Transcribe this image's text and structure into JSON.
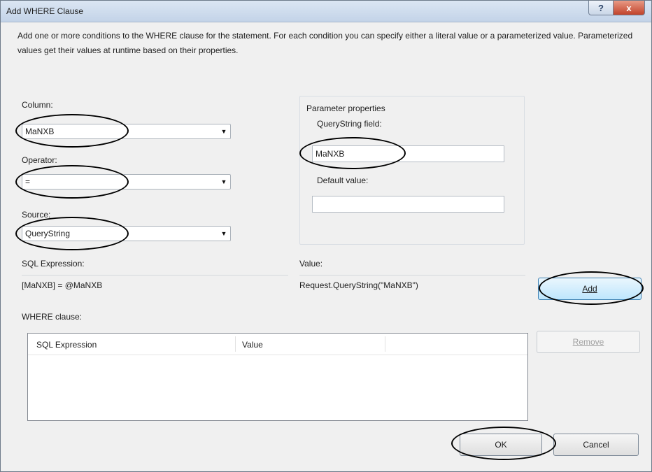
{
  "window": {
    "title": "Add WHERE Clause",
    "help_icon": "?",
    "close_icon": "x"
  },
  "description": "Add one or more conditions to the WHERE clause for the statement. For each condition you can specify either a literal value or a parameterized value. Parameterized values get their values at runtime based on their properties.",
  "column": {
    "label": "Column:",
    "value": "MaNXB"
  },
  "operator": {
    "label": "Operator:",
    "value": "="
  },
  "source": {
    "label": "Source:",
    "value": "QueryString"
  },
  "parameter_properties": {
    "title": "Parameter properties",
    "querystring_label": "QueryString field:",
    "querystring_value": "MaNXB",
    "default_label": "Default value:",
    "default_value": ""
  },
  "sql_expression": {
    "label": "SQL Expression:",
    "value": "[MaNXB] = @MaNXB"
  },
  "value_preview": {
    "label": "Value:",
    "value": "Request.QueryString(\"MaNXB\")"
  },
  "buttons": {
    "add": "Add",
    "remove": "Remove",
    "ok": "OK",
    "cancel": "Cancel"
  },
  "where_clause": {
    "label": "WHERE clause:",
    "columns": [
      "SQL Expression",
      "Value"
    ],
    "rows": []
  },
  "colors": {
    "accent_button": "#bee6fd",
    "close_button": "#c1432b",
    "annotation_ovals": "#000000"
  }
}
